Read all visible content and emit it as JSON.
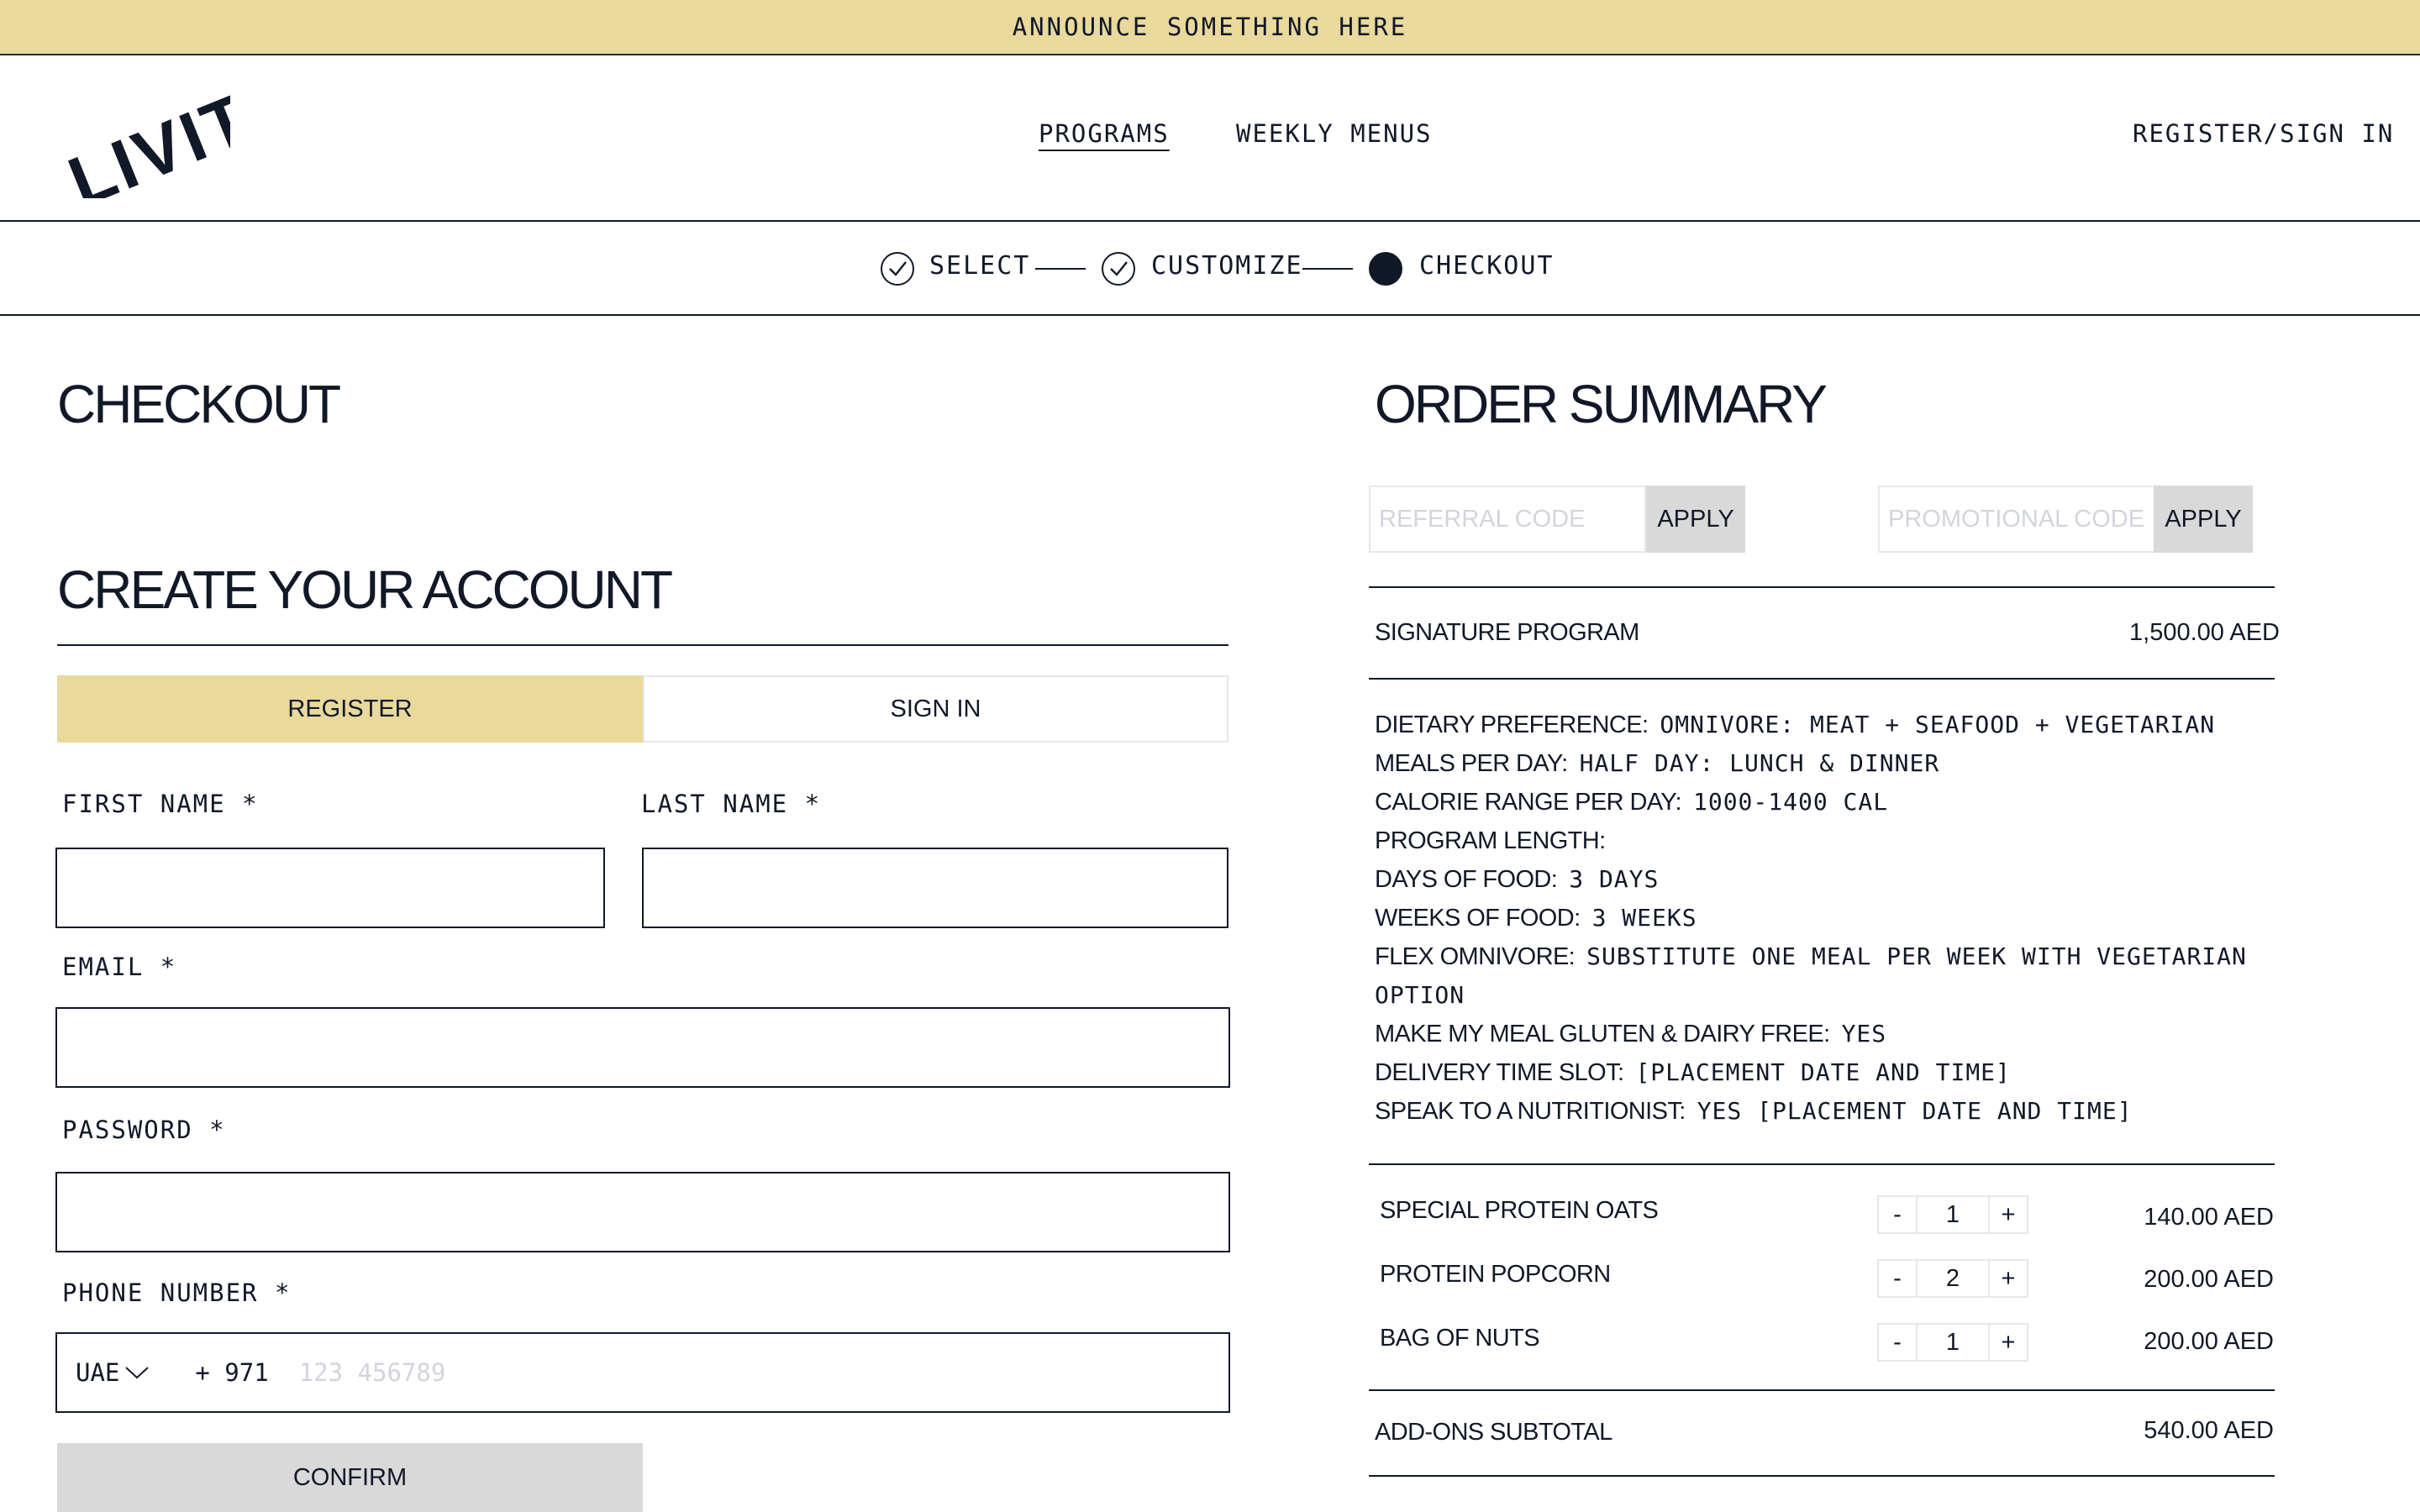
{
  "announcement": "ANNOUNCE SOMETHING HERE",
  "brand": {
    "logo_text": "LIVIT"
  },
  "nav": {
    "programs": "PROGRAMS",
    "weekly_menus": "WEEKLY MENUS",
    "account": "REGISTER/SIGN IN"
  },
  "stepper": {
    "steps": [
      {
        "label": "SELECT",
        "state": "done"
      },
      {
        "label": "CUSTOMIZE",
        "state": "done"
      },
      {
        "label": "CHECKOUT",
        "state": "current"
      }
    ]
  },
  "checkout": {
    "title": "CHECKOUT",
    "account_title": "CREATE YOUR ACCOUNT",
    "tabs": {
      "register": "REGISTER",
      "sign_in": "SIGN IN",
      "active": "register"
    },
    "fields": {
      "first_name": {
        "label": "FIRST NAME *",
        "value": ""
      },
      "last_name": {
        "label": "LAST NAME *",
        "value": ""
      },
      "email": {
        "label": "EMAIL *",
        "value": ""
      },
      "password": {
        "label": "PASSWORD *",
        "value": ""
      },
      "phone": {
        "label": "PHONE NUMBER *",
        "country": "UAE",
        "code": "+ 971",
        "placeholder": "123 456789",
        "value": ""
      }
    },
    "confirm": "CONFIRM"
  },
  "summary": {
    "title": "ORDER SUMMARY",
    "referral": {
      "placeholder": "REFERRAL CODE",
      "button": "APPLY"
    },
    "promo": {
      "placeholder": "PROMOTIONAL CODE",
      "button": "APPLY"
    },
    "program": {
      "name": "SIGNATURE PROGRAM",
      "price": "1,500.00 AED"
    },
    "details": [
      {
        "key": "DIETARY PREFERENCE:",
        "value": "OMNIVORE: MEAT + SEAFOOD + VEGETARIAN"
      },
      {
        "key": "MEALS PER DAY:",
        "value": "HALF DAY: LUNCH & DINNER"
      },
      {
        "key": "CALORIE RANGE PER DAY:",
        "value": "1000-1400 CAL"
      },
      {
        "key": "PROGRAM LENGTH:",
        "value": ""
      },
      {
        "key": "DAYS OF FOOD:",
        "value": "3 DAYS"
      },
      {
        "key": "WEEKS OF FOOD:",
        "value": "3 WEEKS"
      },
      {
        "key": "FLEX OMNIVORE:",
        "value": "SUBSTITUTE ONE MEAL PER WEEK WITH VEGETARIAN"
      },
      {
        "key": "",
        "value": "OPTION"
      },
      {
        "key": "MAKE MY MEAL GLUTEN & DAIRY FREE:",
        "value": "YES"
      },
      {
        "key": "DELIVERY TIME SLOT:",
        "value": "[PLACEMENT DATE AND TIME]"
      },
      {
        "key": "SPEAK TO A NUTRITIONIST:",
        "value": "YES [PLACEMENT DATE AND TIME]"
      }
    ],
    "addons": [
      {
        "name": "SPECIAL PROTEIN OATS",
        "qty": "1",
        "price": "140.00 AED"
      },
      {
        "name": "PROTEIN POPCORN",
        "qty": "2",
        "price": "200.00 AED"
      },
      {
        "name": "BAG OF NUTS",
        "qty": "1",
        "price": "200.00 AED"
      }
    ],
    "qty_minus": "-",
    "qty_plus": "+",
    "addons_subtotal": {
      "label": "ADD-ONS SUBTOTAL",
      "value": "540.00 AED"
    }
  }
}
